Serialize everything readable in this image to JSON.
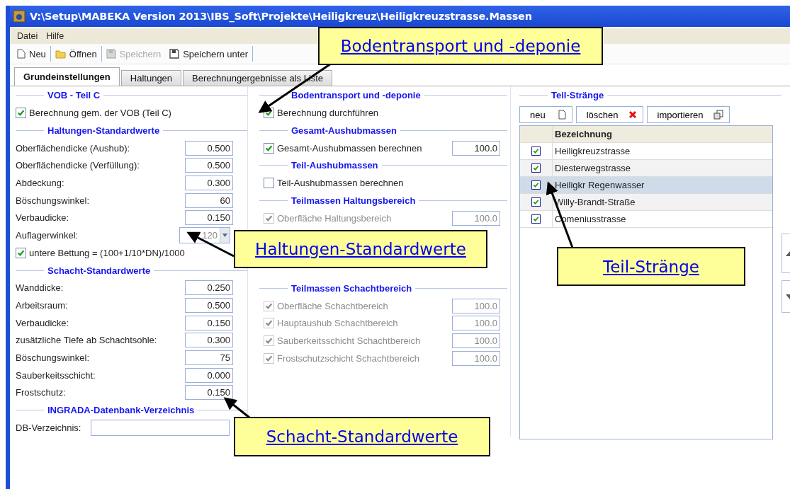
{
  "window": {
    "title": "V:\\Setup\\MABEKA Version 2013\\IBS_Soft\\Projekte\\Heiligkreuz\\Heiligkreuzstrasse.Massen"
  },
  "menu": [
    {
      "label": "Datei"
    },
    {
      "label": "Hilfe"
    }
  ],
  "toolbar": [
    {
      "label": "Neu",
      "disabled": false
    },
    {
      "label": "Öffnen",
      "disabled": false
    },
    {
      "label": "Speichern",
      "disabled": true
    },
    {
      "label": "Speichern unter",
      "disabled": false
    }
  ],
  "tabs": [
    {
      "label": "Grundeinstellungen",
      "selected": true
    },
    {
      "label": "Haltungen",
      "selected": false
    },
    {
      "label": "Berechnungergebnisse als Liste",
      "selected": false
    }
  ],
  "left": {
    "sections": [
      {
        "title": "VOB - Teil C",
        "items": [
          {
            "kind": "check",
            "label": "Berechnung gem. der VOB (Teil C)",
            "checked": true
          }
        ]
      },
      {
        "title": "Haltungen-Standardwerte",
        "items": [
          {
            "kind": "number",
            "label": "Oberflächendicke (Aushub):",
            "value": "0.500"
          },
          {
            "kind": "number",
            "label": "Oberflächendicke (Verfüllung):",
            "value": "0.500"
          },
          {
            "kind": "number",
            "label": "Abdeckung:",
            "value": "0.300"
          },
          {
            "kind": "number",
            "label": "Böschungswinkel:",
            "value": "60"
          },
          {
            "kind": "number",
            "label": "Verbaudicke:",
            "value": "0.150"
          },
          {
            "kind": "combo",
            "label": "Auflagerwinkel:",
            "value": "120",
            "disabled": true
          },
          {
            "kind": "check",
            "label": "untere Bettung = (100+1/10*DN)/1000",
            "checked": true
          }
        ]
      },
      {
        "title": "Schacht-Standardwerte",
        "items": [
          {
            "kind": "number",
            "label": "Wanddicke:",
            "value": "0.250"
          },
          {
            "kind": "number",
            "label": "Arbeitsraum:",
            "value": "0.500"
          },
          {
            "kind": "number",
            "label": "Verbaudicke:",
            "value": "0.150"
          },
          {
            "kind": "number",
            "label": "zusätzliche Tiefe ab Schachtsohle:",
            "value": "0.300"
          },
          {
            "kind": "number",
            "label": "Böschungswinkel:",
            "value": "75"
          },
          {
            "kind": "number",
            "label": "Sauberkeitsschicht:",
            "value": "0.000"
          },
          {
            "kind": "number",
            "label": "Frostschutz:",
            "value": "0.150"
          }
        ]
      },
      {
        "title": "INGRADA-Datenbank-Verzeichnis",
        "items": [
          {
            "kind": "path",
            "label": "DB-Verzeichnis:"
          }
        ]
      }
    ]
  },
  "middle": {
    "sections": [
      {
        "title": "Bodentransport und -deponie",
        "items": [
          {
            "label": "Berechnung durchführen",
            "checked": true,
            "disabled": false
          }
        ]
      },
      {
        "title": "Gesamt-Aushubmassen",
        "items": [
          {
            "label": "Gesamt-Aushubmassen berechnen",
            "checked": true,
            "disabled": false,
            "value": "100.0"
          }
        ]
      },
      {
        "title": "Teil-Aushubmassen",
        "items": [
          {
            "label": "Teil-Aushubmassen berechnen",
            "checked": false,
            "disabled": false
          }
        ]
      },
      {
        "title": "Teilmassen Haltungsbereich",
        "items": [
          {
            "label": "Oberfläche Haltungsbereich",
            "checked": true,
            "disabled": true,
            "value": "100.0"
          }
        ]
      },
      {
        "title": "Teilmassen Schachtbereich",
        "items": [
          {
            "label": "Oberfläche Schachtbereich",
            "checked": true,
            "disabled": true,
            "value": "100.0"
          },
          {
            "label": "Hauptaushub Schachtbereich",
            "checked": true,
            "disabled": true,
            "value": "100.0"
          },
          {
            "label": "Sauberkeitsschicht Schachtbereich",
            "checked": true,
            "disabled": true,
            "value": "100.0"
          },
          {
            "label": "Frostschutzschicht Schachtbereich",
            "checked": true,
            "disabled": true,
            "value": "100.0"
          }
        ]
      }
    ]
  },
  "right": {
    "title": "Teil-Stränge",
    "buttons": [
      {
        "label": "neu"
      },
      {
        "label": "löschen"
      },
      {
        "label": "importieren"
      }
    ],
    "table": {
      "columns": [
        "Bezeichnung"
      ],
      "rows": [
        {
          "name": "Heiligkreuzstrasse",
          "checked": true,
          "selected": false
        },
        {
          "name": "Diesterwegstrasse",
          "checked": true,
          "selected": false
        },
        {
          "name": "Heiligkr Regenwasser",
          "checked": true,
          "selected": true
        },
        {
          "name": "Willy-Brandt-Straße",
          "checked": true,
          "selected": false
        },
        {
          "name": "Comeniusstrasse",
          "checked": true,
          "selected": false
        }
      ]
    }
  },
  "callouts": [
    {
      "text": "Bodentransport und -deponie"
    },
    {
      "text": "Haltungen-Standardwerte"
    },
    {
      "text": "Teil-Stränge"
    },
    {
      "text": "Schacht-Standardwerte"
    }
  ]
}
